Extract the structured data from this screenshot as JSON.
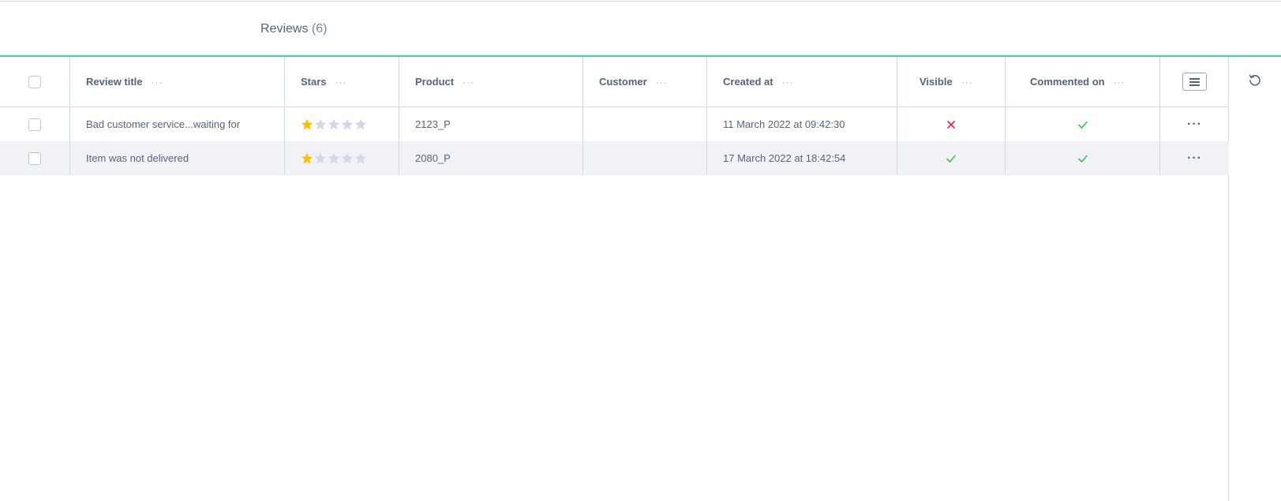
{
  "tab": {
    "title": "Reviews",
    "count": "(6)"
  },
  "columns": {
    "review_title": "Review title",
    "stars": "Stars",
    "product": "Product",
    "customer": "Customer",
    "created_at": "Created at",
    "visible": "Visible",
    "commented_on": "Commented on"
  },
  "context_menu_glyph": "···",
  "row_actions_glyph": "···",
  "rows": [
    {
      "title": "Bad customer service...waiting for",
      "stars": 1,
      "max_stars": 5,
      "product": "2123_P",
      "customer": "",
      "created_at": "11 March 2022 at 09:42:30",
      "visible": false,
      "commented_on": true
    },
    {
      "title": "Item was not delivered",
      "stars": 1,
      "max_stars": 5,
      "product": "2080_P",
      "customer": "",
      "created_at": "17 March 2022 at 18:42:54",
      "visible": true,
      "commented_on": true
    }
  ],
  "colors": {
    "accent": "#37d68b",
    "star_filled": "#ffc107",
    "star_empty": "#d1d9e2",
    "check": "#37c648",
    "cross": "#de294c",
    "text": "#52667a",
    "row_alt": "#f1f2f5"
  },
  "icons": {
    "column_settings": "hamburger-icon",
    "refresh": "refresh-icon",
    "visible_true": "check-icon",
    "visible_false": "cross-icon"
  }
}
